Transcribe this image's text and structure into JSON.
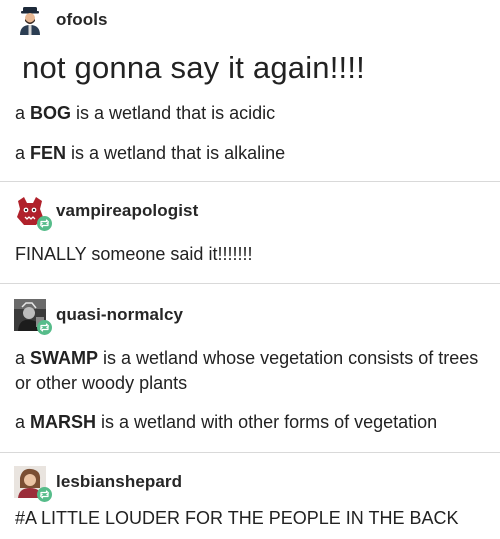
{
  "posts": [
    {
      "username": "ofools",
      "avatar_icon": "person-with-hat-icon",
      "title": "not gonna say it again!!!!",
      "lines": [
        {
          "article": "a ",
          "term": "BOG",
          "rest": " is a wetland that is acidic"
        },
        {
          "article": "a ",
          "term": "FEN",
          "rest": " is a wetland that is alkaline"
        }
      ]
    },
    {
      "username": "vampireapologist",
      "avatar_icon": "red-creature-icon",
      "badge_icon": "reblog-icon",
      "text": "FINALLY someone said it!!!!!!!"
    },
    {
      "username": "quasi-normalcy",
      "avatar_icon": "dark-portrait-icon",
      "badge_icon": "reblog-icon",
      "lines": [
        {
          "article": "a ",
          "term": "SWAMP",
          "rest": " is a wetland whose vegetation consists of trees or other woody plants"
        },
        {
          "article": "a ",
          "term": "MARSH",
          "rest": " is a wetland with other forms of vegetation"
        }
      ]
    },
    {
      "username": "lesbianshepard",
      "avatar_icon": "person-portrait-icon",
      "badge_icon": "reblog-icon",
      "tags": "#A LITTLE LOUDER FOR THE PEOPLE IN THE BACK"
    }
  ],
  "colors": {
    "reblog_badge": "#56bc8a",
    "text": "#222222",
    "divider": "#d9d9d9"
  }
}
